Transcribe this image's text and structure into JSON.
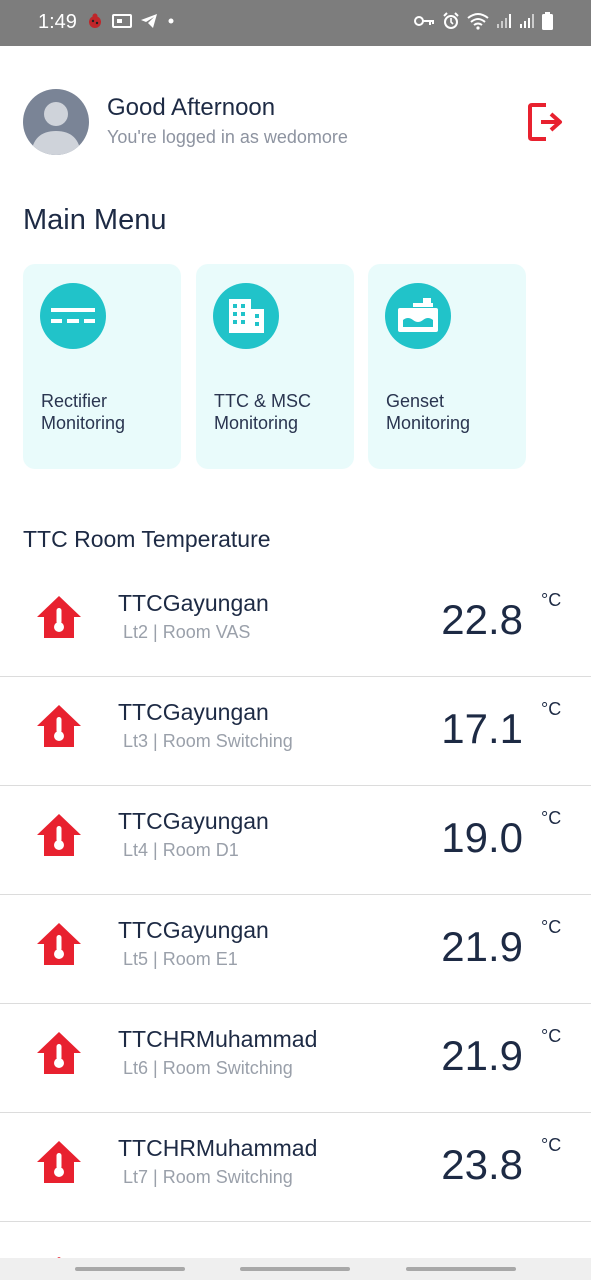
{
  "status_bar": {
    "time": "1:49",
    "left_icons": [
      "bug-icon",
      "bank-icon",
      "telegram-icon",
      "dot-icon"
    ],
    "right_icons": [
      "key-icon",
      "alarm-icon",
      "wifi-icon",
      "signal-icon",
      "signal-icon",
      "battery-icon"
    ]
  },
  "header": {
    "greeting": "Good Afternoon",
    "login_line": "You're logged in as wedomore",
    "logout_icon": "logout-icon"
  },
  "main_menu": {
    "title": "Main Menu",
    "items": [
      {
        "label": "Rectifier Monitoring",
        "icon": "rectifier-icon"
      },
      {
        "label": "TTC & MSC Monitoring",
        "icon": "building-icon"
      },
      {
        "label": "Genset Monitoring",
        "icon": "genset-icon"
      }
    ]
  },
  "room_temperature": {
    "title": "TTC Room Temperature",
    "unit": "°C",
    "rows": [
      {
        "site": "TTCGayungan",
        "room": "Lt2 | Room VAS",
        "value": "22.8"
      },
      {
        "site": "TTCGayungan",
        "room": "Lt3 | Room Switching",
        "value": "17.1"
      },
      {
        "site": "TTCGayungan",
        "room": "Lt4 | Room D1",
        "value": "19.0"
      },
      {
        "site": "TTCGayungan",
        "room": "Lt5 | Room E1",
        "value": "21.9"
      },
      {
        "site": "TTCHRMuhammad",
        "room": "Lt6 | Room Switching",
        "value": "21.9"
      },
      {
        "site": "TTCHRMuhammad",
        "room": "Lt7 | Room Switching",
        "value": "23.8"
      }
    ]
  },
  "colors": {
    "accent_teal": "#21c3c9",
    "card_bg": "#e9fbfb",
    "alert_red": "#e8212f",
    "text_dark": "#1d2a44"
  }
}
